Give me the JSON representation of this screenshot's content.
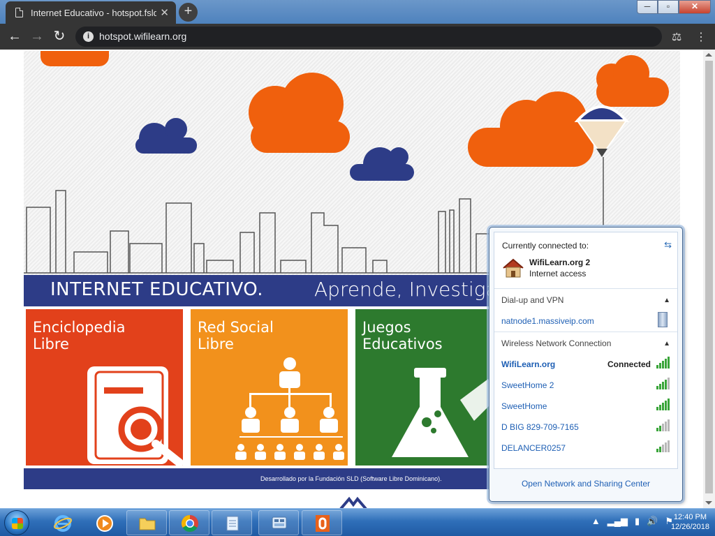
{
  "browser": {
    "tab_title": "Internet Educativo - hotspot.fsld.",
    "url": "hotspot.wifilearn.org",
    "new_tab_symbol": "+",
    "close_tab_symbol": "✕",
    "window_buttons": {
      "minimize": "─",
      "maximize": "▫",
      "close": "✕"
    }
  },
  "page": {
    "banner_title": "INTERNET EDUCATIVO.",
    "banner_subtitle": "Aprende, Investiga",
    "tiles": [
      {
        "label": "Enciclopedia\nLibre",
        "color": "#e2411b"
      },
      {
        "label": "Red Social\nLibre",
        "color": "#f2911c"
      },
      {
        "label": "Juegos\nEducativos",
        "color": "#2d7a2e"
      }
    ],
    "footer": "Desarrollado por la Fundación SLD (Software Libre Dominicano).",
    "colors": {
      "cloud_orange": "#f0600d",
      "cloud_navy": "#2d3c87"
    }
  },
  "network_popup": {
    "header": "Currently connected to:",
    "current_network": "WifiLearn.org  2",
    "current_status": "Internet access",
    "dialup_section": "Dial-up and VPN",
    "vpn_item": "natnode1.massiveip.com",
    "wireless_section": "Wireless Network Connection",
    "networks": [
      {
        "name": "WifiLearn.org",
        "status": "Connected",
        "strength": 5,
        "secured": false,
        "warning": true
      },
      {
        "name": "SweetHome 2",
        "status": "",
        "strength": 4
      },
      {
        "name": "SweetHome",
        "status": "",
        "strength": 5
      },
      {
        "name": "D BIG 829-709-7165",
        "status": "",
        "strength": 2
      },
      {
        "name": "DELANCER0257",
        "status": "",
        "strength": 2
      }
    ],
    "open_center": "Open Network and Sharing Center"
  },
  "taskbar": {
    "time": "12:40 PM",
    "date": "12/26/2018"
  }
}
